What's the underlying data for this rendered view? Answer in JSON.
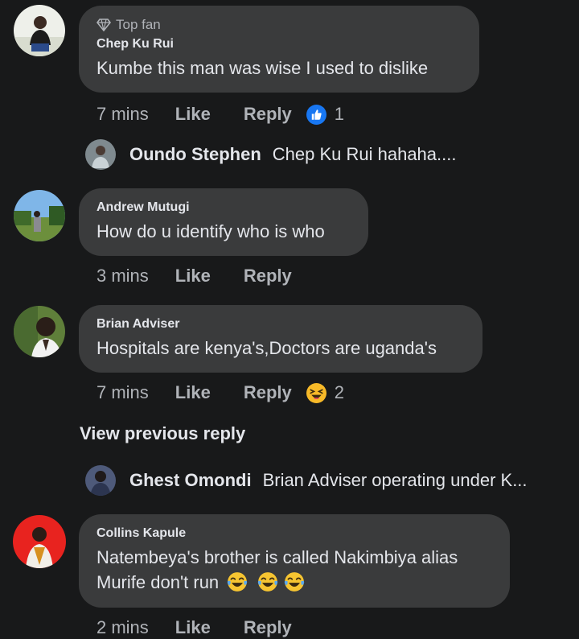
{
  "comments": [
    {
      "badge": "Top fan",
      "author": "Chep Ku Rui",
      "text": "Kumbe this man was wise I used to dislike",
      "time": "7 mins",
      "like_label": "Like",
      "reply_label": "Reply",
      "reaction": "like-reaction-icon",
      "reaction_count": "1"
    },
    {
      "author": "Andrew Mutugi",
      "text": "How do u identify who is who",
      "time": "3 mins",
      "like_label": "Like",
      "reply_label": "Reply"
    },
    {
      "author": "Brian Adviser",
      "text": "Hospitals are kenya's,Doctors are uganda's",
      "time": "7 mins",
      "like_label": "Like",
      "reply_label": "Reply",
      "reaction": "haha-reaction-icon",
      "reaction_count": "2"
    },
    {
      "author": "Collins Kapule",
      "text_line1": "Natembeya's brother is called Nakimbiya alias",
      "text_line2": "Murife don't run",
      "text_emojis": [
        "tears-of-joy-emoji",
        "tears-of-joy-emoji",
        "tears-of-joy-emoji"
      ],
      "time": "2 mins",
      "like_label": "Like",
      "reply_label": "Reply"
    }
  ],
  "replies": [
    {
      "author": "Oundo Stephen",
      "text": "Chep Ku Rui hahaha...."
    },
    {
      "author": "Ghest Omondi",
      "text": "Brian Adviser operating under K..."
    }
  ],
  "view_previous_reply": "View previous reply",
  "colors": {
    "background": "#18191a",
    "bubble": "#3a3b3c",
    "secondary_text": "#b0b3b8",
    "primary_text": "#e4e6eb",
    "like_blue": "#1877f2",
    "haha_yellow": "#f7b928"
  }
}
